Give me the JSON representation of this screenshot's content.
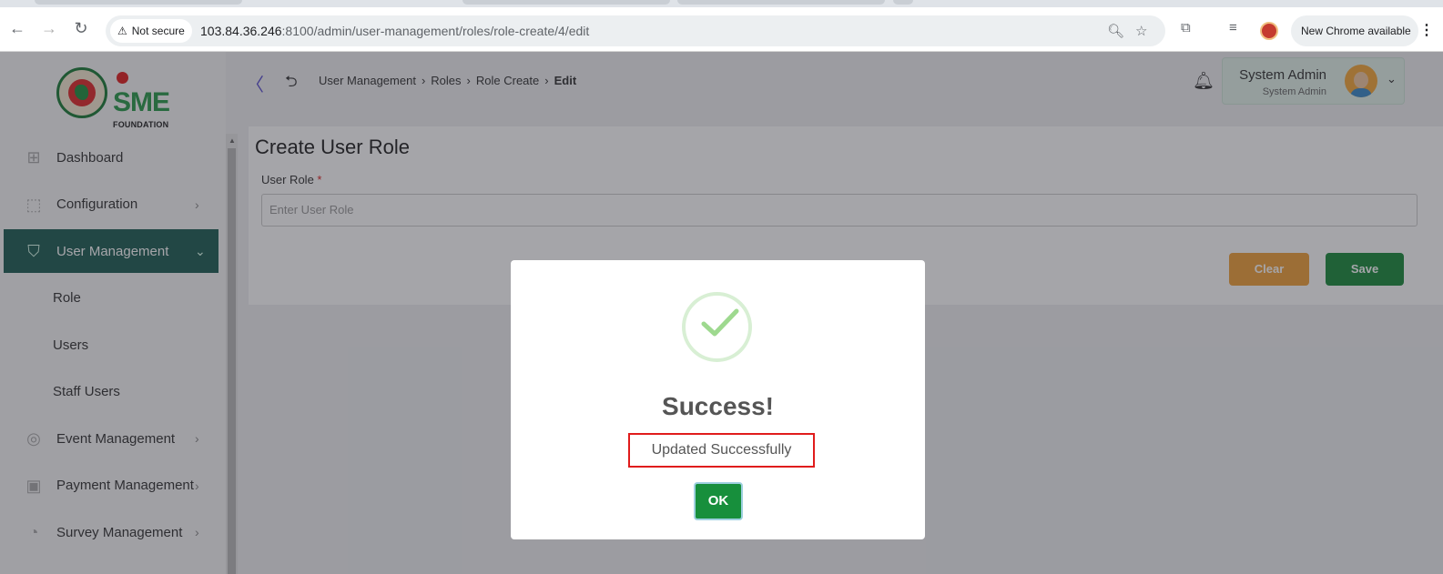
{
  "browser": {
    "security_label": "Not secure",
    "url_host": "103.84.36.246",
    "url_path": ":8100/admin/user-management/roles/role-create/4/edit",
    "update_label": "New Chrome available"
  },
  "brand": {
    "logo_text": "SME",
    "logo_subtext": "FOUNDATION"
  },
  "sidebar": {
    "items": [
      {
        "label": "Dashboard",
        "icon": "grid-icon"
      },
      {
        "label": "Configuration",
        "icon": "config-icon"
      },
      {
        "label": "User Management",
        "icon": "shield-icon"
      },
      {
        "label": "Role"
      },
      {
        "label": "Users"
      },
      {
        "label": "Staff Users"
      },
      {
        "label": "Event Management",
        "icon": "event-icon"
      },
      {
        "label": "Payment Management",
        "icon": "payment-icon"
      },
      {
        "label": "Survey Management",
        "icon": "pie-icon"
      }
    ]
  },
  "breadcrumb": {
    "items": [
      "User Management",
      "Roles",
      "Role Create",
      "Edit"
    ]
  },
  "user": {
    "name": "System Admin",
    "role": "System Admin"
  },
  "form": {
    "title": "Create User Role",
    "field_label": "User Role",
    "required_mark": "*",
    "placeholder": "Enter User Role",
    "clear_label": "Clear",
    "save_label": "Save"
  },
  "modal": {
    "title": "Success!",
    "message": "Updated Successfully",
    "ok_label": "OK"
  },
  "colors": {
    "primary": "#1e5e54",
    "save": "#1a8b3c",
    "clear": "#f0a13a",
    "highlight": "#e01c1c"
  }
}
